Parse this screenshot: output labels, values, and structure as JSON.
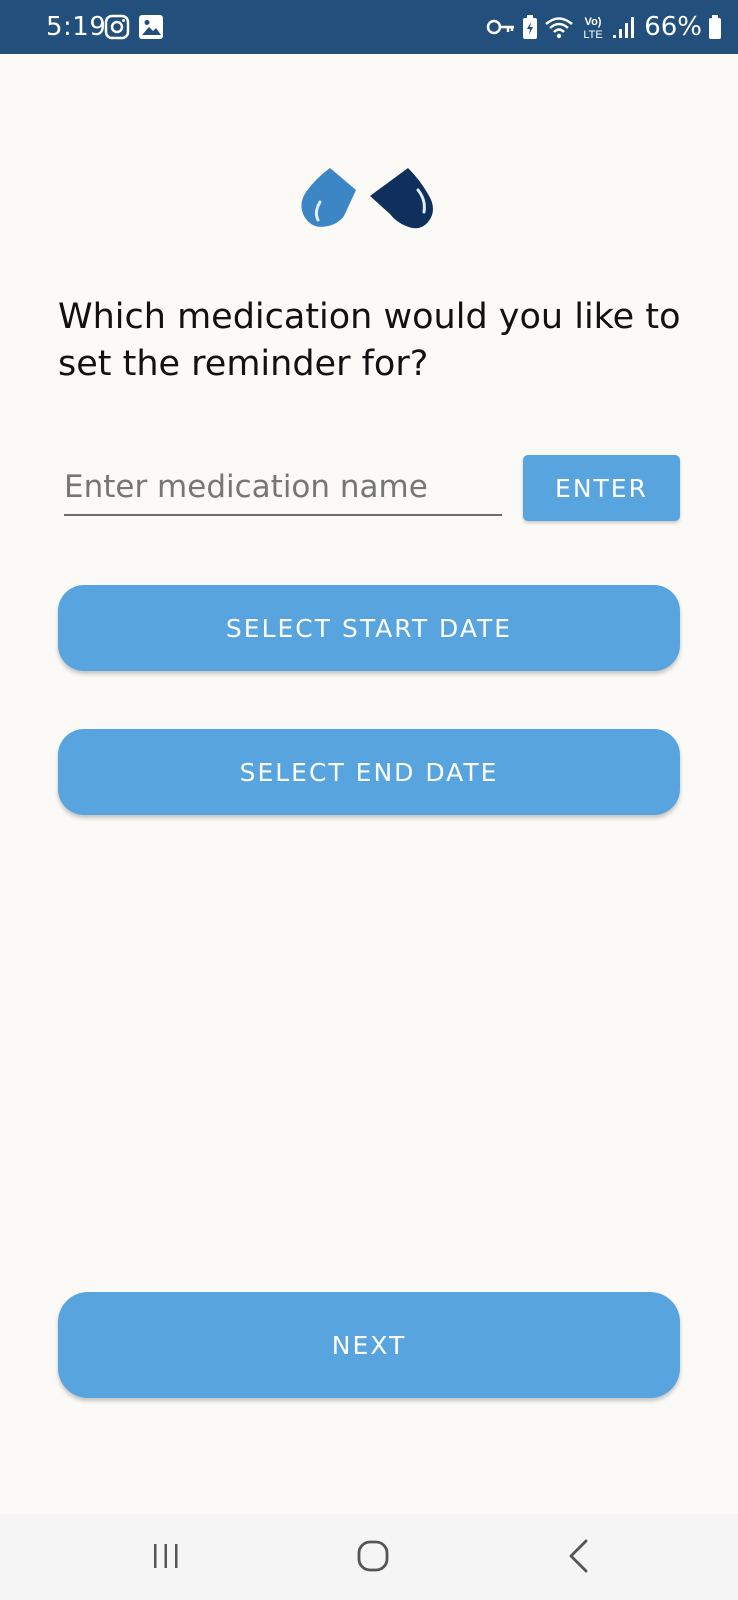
{
  "status_bar": {
    "time": "5:19",
    "battery_text": "66%",
    "icons_left": [
      "instagram-icon",
      "gallery-icon"
    ],
    "icons_right": [
      "vpn-key-icon",
      "battery-saver-icon",
      "wifi-icon",
      "volte-icon",
      "signal-icon",
      "battery-icon"
    ],
    "background": "#224f7b"
  },
  "main": {
    "question": "Which medication would you like to set the reminder for?",
    "medication_input": {
      "placeholder": "Enter medication name",
      "value": ""
    },
    "enter_label": "ENTER",
    "start_date_label": "SELECT START DATE",
    "end_date_label": "SELECT END DATE",
    "next_label": "NEXT",
    "accent_color": "#58a4df"
  },
  "logo": {
    "icons": [
      "drop-icon-light",
      "drop-icon-dark"
    ],
    "colors": [
      "#3d86c6",
      "#0f2f5c"
    ]
  },
  "nav_bar": {
    "icons": [
      "recents-icon",
      "home-icon",
      "back-icon"
    ]
  }
}
